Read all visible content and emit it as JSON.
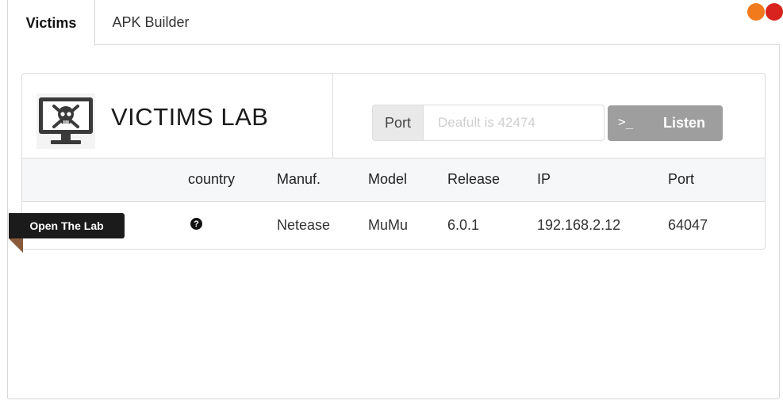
{
  "tabs": [
    {
      "label": "Victims",
      "active": true
    },
    {
      "label": "APK Builder",
      "active": false
    }
  ],
  "window_controls": {
    "colors": [
      "#f07a1c",
      "#d8231f"
    ]
  },
  "lab": {
    "title": "VICTIMS LAB",
    "logo_icon": "computer-skull-icon",
    "port_label": "Port",
    "port_placeholder": "Deafult is 42474",
    "listen_button": {
      "icon": ">_",
      "label": "Listen"
    }
  },
  "table": {
    "columns": [
      "country",
      "Manuf.",
      "Model",
      "Release",
      "IP",
      "Port"
    ],
    "rows": [
      {
        "action_label": "Open The Lab",
        "country_icon": "question-circle-icon",
        "manufacturer": "Netease",
        "model": "MuMu",
        "release": "6.0.1",
        "ip": "192.168.2.12",
        "port": "64047"
      }
    ]
  }
}
